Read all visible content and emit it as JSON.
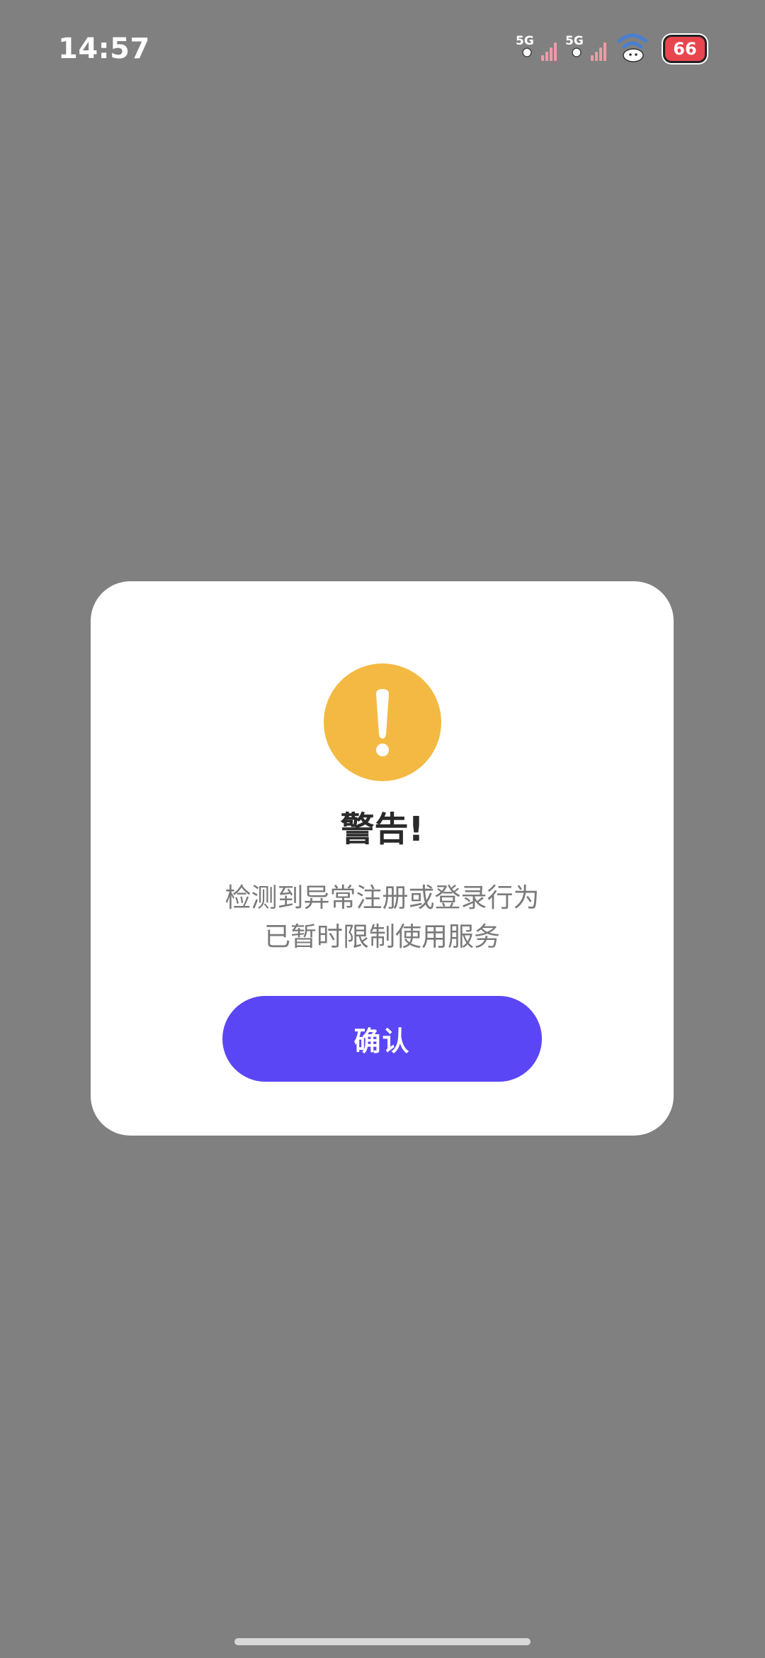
{
  "status_bar": {
    "time": "14:57",
    "sim1_tag": "5G",
    "sim2_tag": "5G",
    "battery_level": "66",
    "icons": [
      "signal-5g-icon",
      "signal-5g-icon",
      "wifi-icon",
      "battery-icon"
    ]
  },
  "dialog": {
    "icon": "warning-icon",
    "title": "警告!",
    "message_line1": "检测到异常注册或登录行为",
    "message_line2": "已暂时限制使用服务",
    "confirm_label": "确认"
  },
  "colors": {
    "overlay": "#808080",
    "warning": "#f4b942",
    "accent": "#5b46f5",
    "battery": "#e8454f"
  }
}
